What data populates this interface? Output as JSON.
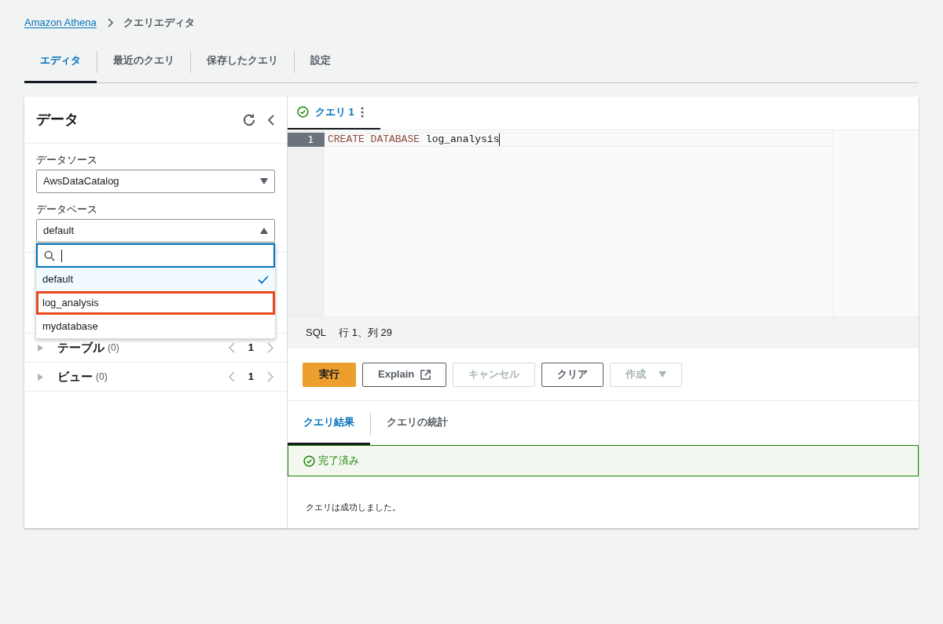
{
  "breadcrumb": [
    {
      "label": "Amazon Athena",
      "kind": "link"
    },
    {
      "label": "クエリエディタ",
      "kind": "current"
    }
  ],
  "tabs": [
    {
      "label": "エディタ",
      "selected": true
    },
    {
      "label": "最近のクエリ",
      "selected": false
    },
    {
      "label": "保存したクエリ",
      "selected": false
    },
    {
      "label": "設定",
      "selected": false
    }
  ],
  "data_panel": {
    "title": "データ",
    "data_source": {
      "label": "データソース",
      "value": "AwsDataCatalog"
    },
    "database": {
      "label": "データベース",
      "value": "default",
      "expanded": true
    },
    "dropdown_options": [
      {
        "label": "default",
        "selected": true,
        "highlighted": false
      },
      {
        "label": "log_analysis",
        "selected": false,
        "highlighted": true
      },
      {
        "label": "mydatabase",
        "selected": false,
        "highlighted": false
      }
    ],
    "sections": [
      {
        "label": "テーブル",
        "count": "(0)",
        "page": "1"
      },
      {
        "label": "ビュー",
        "count": "(0)",
        "page": "1"
      }
    ]
  },
  "editor": {
    "query_tab": {
      "label": "クエリ 1",
      "selected": true
    },
    "line_number": "1",
    "code": [
      {
        "text": "CREATE DATABASE",
        "kind": "keyword"
      },
      {
        "text": "log_analysis",
        "kind": "identifier"
      }
    ],
    "status_bar": {
      "language": "SQL",
      "cursor": "行 1、列 29"
    }
  },
  "actions": [
    {
      "label": "実行",
      "kind": "primary",
      "disabled": false
    },
    {
      "label": "Explain",
      "kind": "external",
      "disabled": false
    },
    {
      "label": "キャンセル",
      "kind": "normal",
      "disabled": true
    },
    {
      "label": "クリア",
      "kind": "normal",
      "disabled": false
    },
    {
      "label": "作成",
      "kind": "dropdown",
      "disabled": true
    }
  ],
  "result_tabs": [
    {
      "label": "クエリ結果",
      "selected": true
    },
    {
      "label": "クエリの統計",
      "selected": false
    }
  ],
  "result": {
    "status": "完了済み",
    "message": "クエリは成功しました。"
  }
}
